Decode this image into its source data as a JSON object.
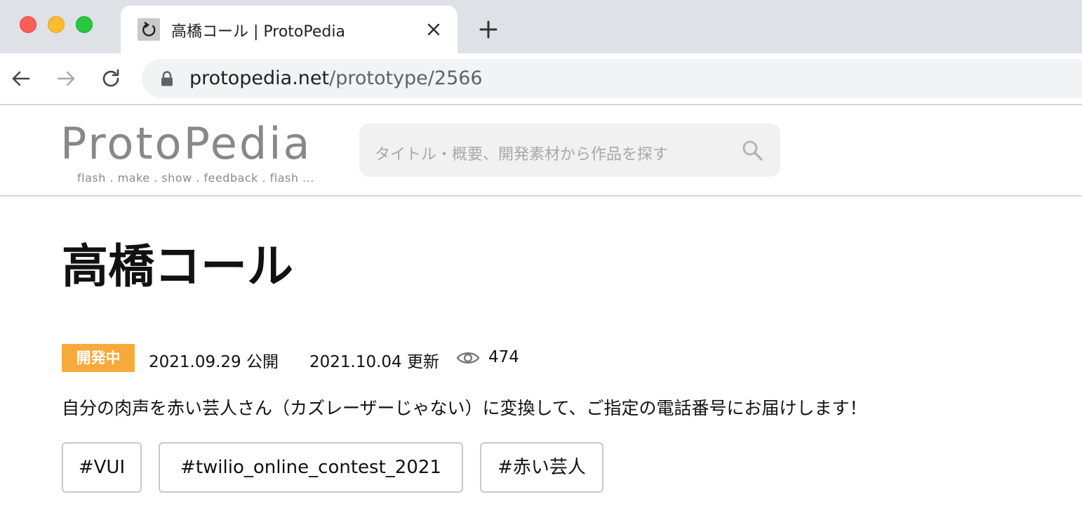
{
  "browser": {
    "tab": {
      "title": "高橋コール | ProtoPedia",
      "favicon": "reload-icon"
    },
    "url": {
      "host": "protopedia.net",
      "path": "/prototype/2566"
    }
  },
  "header": {
    "logo": {
      "text": "ProtoPedia",
      "tagline": "flash . make . show . feedback . flash ..."
    },
    "search": {
      "placeholder": "タイトル・概要、開発素材から作品を探す"
    }
  },
  "prototype": {
    "title": "高橋コール",
    "status": "開発中",
    "published": "2021.09.29 公開",
    "updated": "2021.10.04 更新",
    "views": "474",
    "summary": "自分の肉声を赤い芸人さん（カズレーザーじゃない）に変換して、ご指定の電話番号にお届けします！",
    "tags": [
      "#VUI",
      "#twilio_online_contest_2021",
      "#赤い芸人"
    ]
  },
  "colors": {
    "status_badge": "#f8a93b",
    "logo_gray": "#888888",
    "tab_bar": "#dee1e6"
  }
}
